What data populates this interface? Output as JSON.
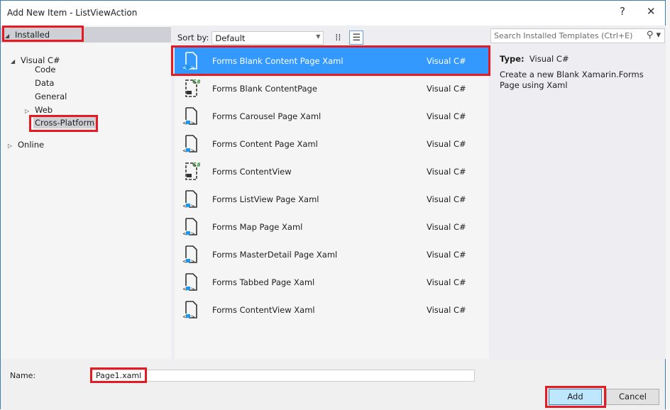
{
  "window": {
    "title": "Add New Item - ListViewAction",
    "help": "?",
    "close": "✕"
  },
  "tree": {
    "installed": "Installed",
    "visual_csharp": "Visual C#",
    "children": [
      "Code",
      "Data",
      "General",
      "Web",
      "Cross-Platform"
    ],
    "online": "Online"
  },
  "toolbar": {
    "sort_label": "Sort by:",
    "sort_value": "Default"
  },
  "search": {
    "placeholder": "Search Installed Templates (Ctrl+E)"
  },
  "templates": [
    {
      "name": "Forms Blank Content Page Xaml",
      "lang": "Visual C#",
      "icon": "xaml"
    },
    {
      "name": "Forms Blank ContentPage",
      "lang": "Visual C#",
      "icon": "cs"
    },
    {
      "name": "Forms Carousel Page Xaml",
      "lang": "Visual C#",
      "icon": "xaml"
    },
    {
      "name": "Forms Content Page Xaml",
      "lang": "Visual C#",
      "icon": "xaml"
    },
    {
      "name": "Forms ContentView",
      "lang": "Visual C#",
      "icon": "cs"
    },
    {
      "name": "Forms ListView Page Xaml",
      "lang": "Visual C#",
      "icon": "xaml"
    },
    {
      "name": "Forms Map Page Xaml",
      "lang": "Visual C#",
      "icon": "xaml"
    },
    {
      "name": "Forms MasterDetail Page Xaml",
      "lang": "Visual C#",
      "icon": "xaml"
    },
    {
      "name": "Forms Tabbed Page Xaml",
      "lang": "Visual C#",
      "icon": "xaml"
    },
    {
      "name": "Forms ContentView Xaml",
      "lang": "Visual C#",
      "icon": "xaml"
    }
  ],
  "details": {
    "type_label": "Type:",
    "type_value": "Visual C#",
    "description": "Create a new Blank Xamarin.Forms Page using Xaml"
  },
  "footer": {
    "name_label": "Name:",
    "name_value": "Page1.xaml",
    "add": "Add",
    "cancel": "Cancel"
  },
  "colors": {
    "highlight": "#e51b24",
    "selection": "#3399ff"
  }
}
